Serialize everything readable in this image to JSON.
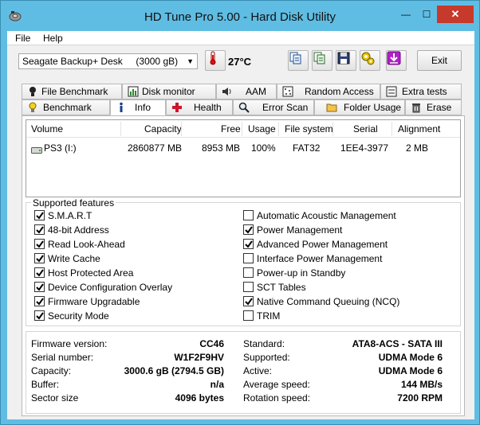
{
  "window": {
    "title": "HD Tune Pro 5.00 - Hard Disk Utility",
    "controls": {
      "minimize": "—",
      "maximize": "☐",
      "close": "✕"
    }
  },
  "menu": {
    "file": "File",
    "help": "Help"
  },
  "toolbar": {
    "drive": "Seagate Backup+ Desk     (3000 gB)",
    "temperature": "27°C",
    "exit_label": "Exit",
    "icons": [
      "thermometer-icon",
      "copy-icon",
      "copy-text-icon",
      "save-icon",
      "options-icon",
      "download-icon"
    ]
  },
  "tabs": {
    "top": [
      "File Benchmark",
      "Disk monitor",
      "AAM",
      "Random Access",
      "Extra tests"
    ],
    "bottom": [
      "Benchmark",
      "Info",
      "Health",
      "Error Scan",
      "Folder Usage",
      "Erase"
    ],
    "active": "Info"
  },
  "volumes": {
    "columns": [
      "Volume",
      "Capacity",
      "Free",
      "Usage",
      "File system",
      "Serial",
      "Alignment"
    ],
    "rows": [
      {
        "volume": "PS3 (I:)",
        "capacity": "2860877 MB",
        "free": "8953 MB",
        "usage": "100%",
        "fs": "FAT32",
        "serial": "1EE4-3977",
        "alignment": "2 MB"
      }
    ]
  },
  "features": {
    "legend": "Supported features",
    "left": [
      {
        "label": "S.M.A.R.T",
        "checked": true
      },
      {
        "label": "48-bit Address",
        "checked": true
      },
      {
        "label": "Read Look-Ahead",
        "checked": true
      },
      {
        "label": "Write Cache",
        "checked": true
      },
      {
        "label": "Host Protected Area",
        "checked": true
      },
      {
        "label": "Device Configuration Overlay",
        "checked": true
      },
      {
        "label": "Firmware Upgradable",
        "checked": true
      },
      {
        "label": "Security Mode",
        "checked": true
      }
    ],
    "right": [
      {
        "label": "Automatic Acoustic Management",
        "checked": false
      },
      {
        "label": "Power Management",
        "checked": true
      },
      {
        "label": "Advanced Power Management",
        "checked": true
      },
      {
        "label": "Interface Power Management",
        "checked": false
      },
      {
        "label": "Power-up in Standby",
        "checked": false
      },
      {
        "label": "SCT Tables",
        "checked": false
      },
      {
        "label": "Native Command Queuing (NCQ)",
        "checked": true
      },
      {
        "label": "TRIM",
        "checked": false
      }
    ]
  },
  "info": {
    "left": [
      {
        "label": "Firmware version:",
        "value": "CC46"
      },
      {
        "label": "Serial number:",
        "value": "W1F2F9HV"
      },
      {
        "label": "Capacity:",
        "value": "3000.6 gB (2794.5 GB)"
      },
      {
        "label": "Buffer:",
        "value": "n/a"
      },
      {
        "label": "Sector size",
        "value": "4096 bytes"
      }
    ],
    "right": [
      {
        "label": "Standard:",
        "value": "ATA8-ACS - SATA III"
      },
      {
        "label": "Supported:",
        "value": "UDMA Mode 6"
      },
      {
        "label": "Active:",
        "value": "UDMA Mode 6"
      },
      {
        "label": "Average speed:",
        "value": "144 MB/s"
      },
      {
        "label": "Rotation speed:",
        "value": "7200 RPM"
      }
    ]
  },
  "colors": {
    "titlebar": "#5fbde3",
    "close": "#c7392b",
    "check": "#000000"
  }
}
